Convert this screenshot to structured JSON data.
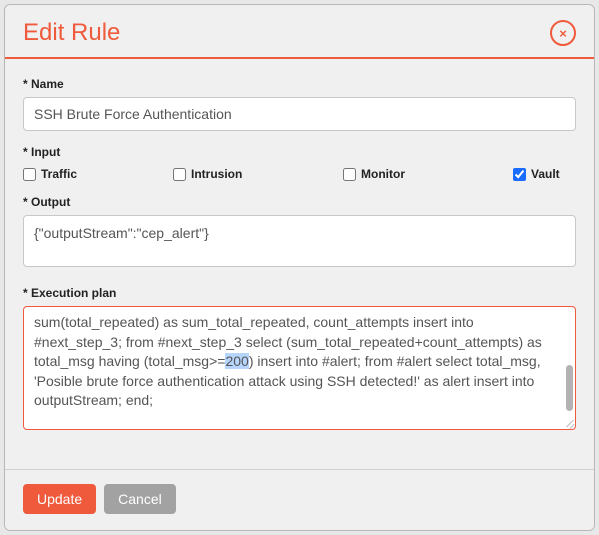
{
  "modal": {
    "title": "Edit Rule",
    "close_label": "×"
  },
  "form": {
    "name": {
      "label": "* Name",
      "value": "SSH Brute Force Authentication"
    },
    "input": {
      "label": "* Input",
      "options": {
        "traffic": {
          "label": "Traffic",
          "checked": false
        },
        "intrusion": {
          "label": "Intrusion",
          "checked": false
        },
        "monitor": {
          "label": "Monitor",
          "checked": false
        },
        "vault": {
          "label": "Vault",
          "checked": true
        }
      }
    },
    "output": {
      "label": "* Output",
      "value": "{\"outputStream\":\"cep_alert\"}"
    },
    "execution_plan": {
      "label": "* Execution plan",
      "highlight_value": "200",
      "line_pre": "sum(total_repeated) as sum_total_repeated, count_attempts insert into #next_step_3; from #next_step_3 select (sum_total_repeated+count_attempts) as total_msg having (total_msg>=",
      "line_post": ") insert into #alert; from #alert select total_msg, 'Posible brute force authentication attack using SSH detected!' as alert insert into outputStream; end;"
    }
  },
  "footer": {
    "update_label": "Update",
    "cancel_label": "Cancel"
  }
}
